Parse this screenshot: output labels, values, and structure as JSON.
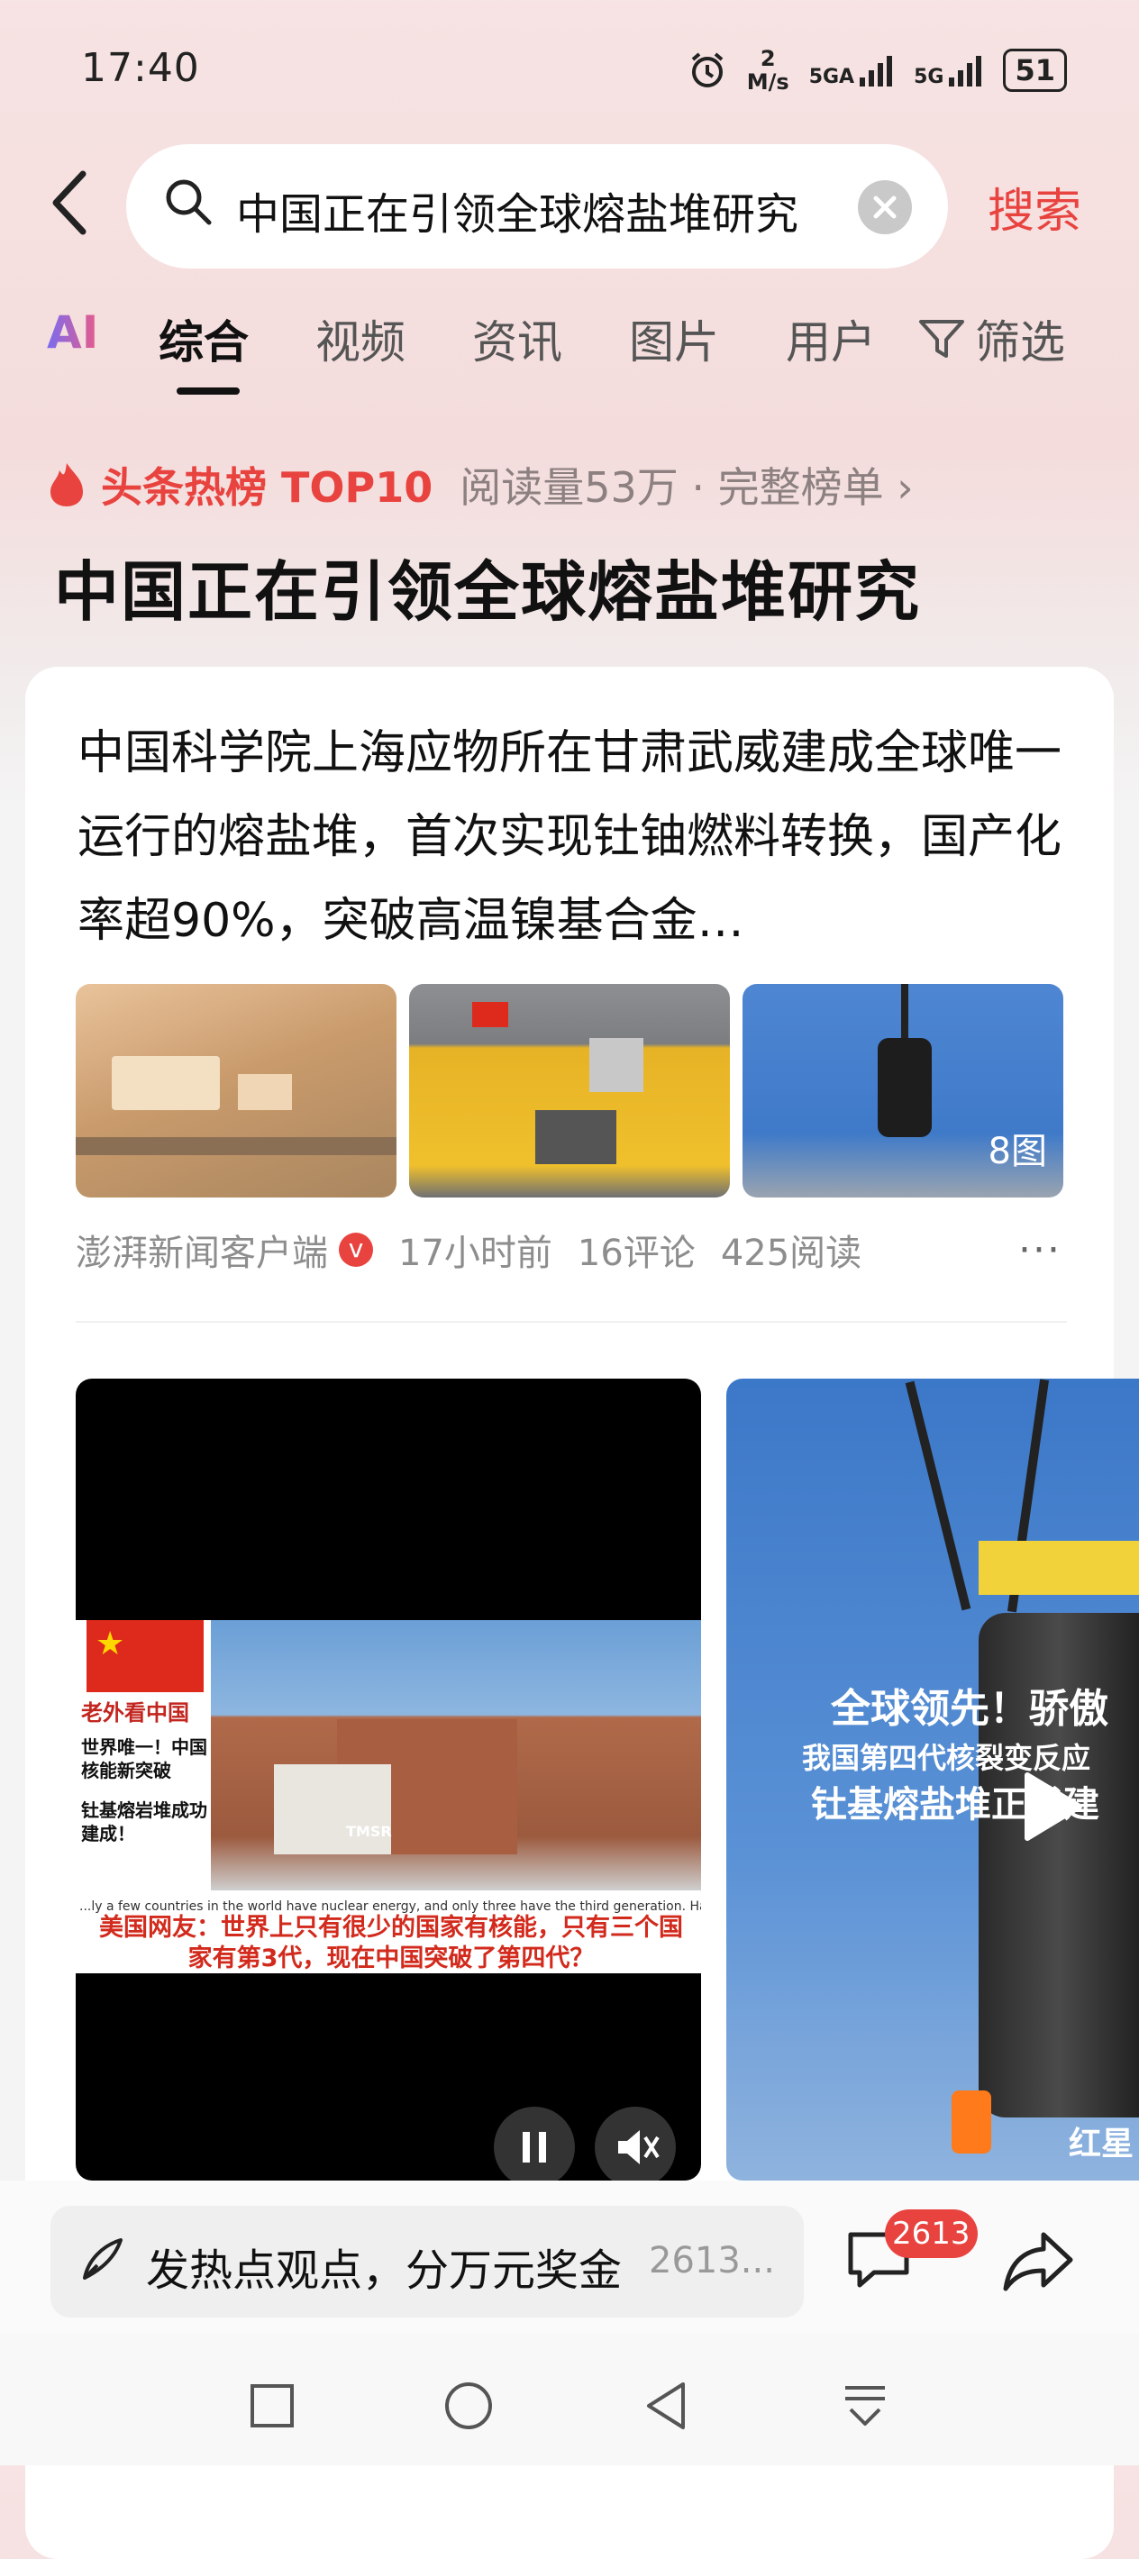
{
  "status_bar": {
    "time": "17:40",
    "speed_top": "2",
    "speed_unit": "M/s",
    "network1": "5GA",
    "network2": "5G",
    "battery": "51"
  },
  "search": {
    "query": "中国正在引领全球熔盐堆研究",
    "button_label": "搜索"
  },
  "tabs": {
    "ai": "AI",
    "items": [
      "综合",
      "视频",
      "资讯",
      "图片",
      "用户"
    ],
    "filter": "筛选"
  },
  "hot": {
    "label": "头条热榜 TOP10",
    "meta": "阅读量53万 · 完整榜单 ›"
  },
  "headline": "中国正在引领全球熔盐堆研究",
  "article": {
    "text": "中国科学院上海应物所在甘肃武威建成全球唯一运行的熔盐堆，首次实现钍铀燃料转换，国产化率超90%，突破高温镍基合金…",
    "image_count": "8图",
    "source": "澎湃新闻客户端",
    "verified_badge": "v",
    "time": "17小时前",
    "comments": "16评论",
    "reads": "425阅读",
    "more": "···"
  },
  "video1": {
    "side_title": "老外看中国",
    "side_text": "世界唯一！中国核能新突破",
    "side_text2": "钍基熔岩堆成功建成！",
    "sign_text": "TMSR",
    "english_caption": "...ly a few countries in the world have nuclear energy, and only three have the third generation. Has China now broken through the fourth gen...",
    "caption": "美国网友：世界上只有很少的国家有核能，只有三个国家有第3代，现在中国突破了第四代？"
  },
  "video2": {
    "title": "全球领先！骄傲",
    "subtitle1": "我国第四代核裂变反应",
    "subtitle2": "钍基熔盐堆正式建",
    "watermark": "红星"
  },
  "bottom": {
    "post_prompt": "发热点观点，分万元奖金",
    "post_count": "2613...",
    "comment_badge": "2613"
  },
  "colors": {
    "accent": "#e8433f",
    "background_top": "#f7e3e3"
  }
}
